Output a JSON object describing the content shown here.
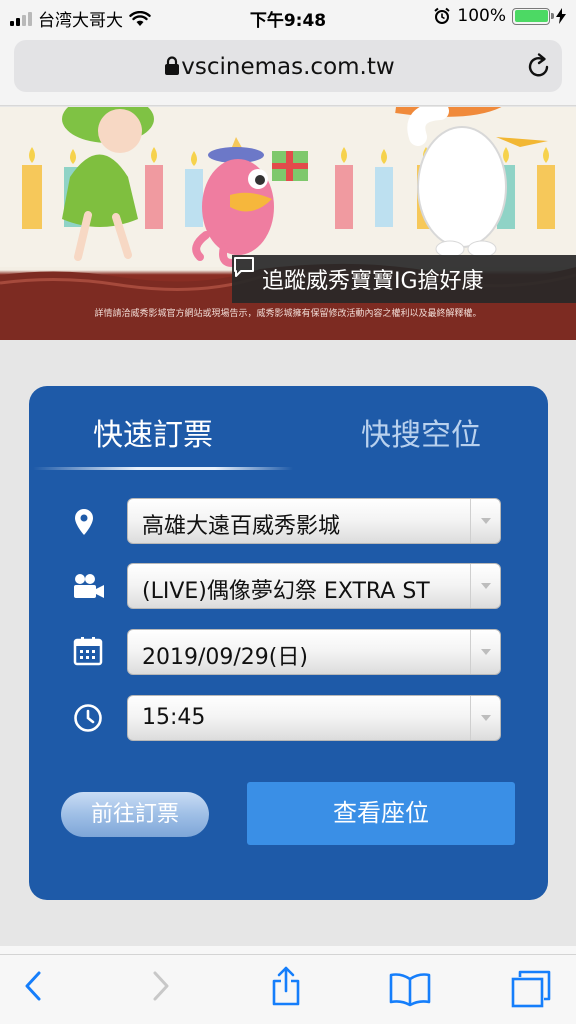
{
  "status_bar": {
    "carrier": "台湾大哥大",
    "time": "下午9:48",
    "battery": "100%"
  },
  "browser": {
    "url": "vscinemas.com.tw"
  },
  "banner": {
    "follow_text": "追蹤威秀寶寶IG搶好康",
    "fine_print": "詳情請洽威秀影城官方網站或現場告示，威秀影城擁有保留修改活動內容之權利以及最終解釋權。"
  },
  "booking": {
    "tabs": [
      {
        "label": "快速訂票",
        "active": true
      },
      {
        "label": "快搜空位",
        "active": false
      }
    ],
    "theater": "高雄大遠百威秀影城",
    "movie": "(LIVE)偶像夢幻祭 EXTRA ST",
    "date": "2019/09/29(日)",
    "time": "15:45",
    "goto_button": "前往訂票",
    "seat_button": "查看座位"
  },
  "colors": {
    "panel": "#1e5aa8",
    "primary_button": "#3a8fe6",
    "ios_blue": "#157efb"
  },
  "icons": [
    "location-icon",
    "video-camera-icon",
    "calendar-icon",
    "clock-icon",
    "back-icon",
    "forward-icon",
    "share-icon",
    "bookmarks-icon",
    "tabs-icon"
  ]
}
